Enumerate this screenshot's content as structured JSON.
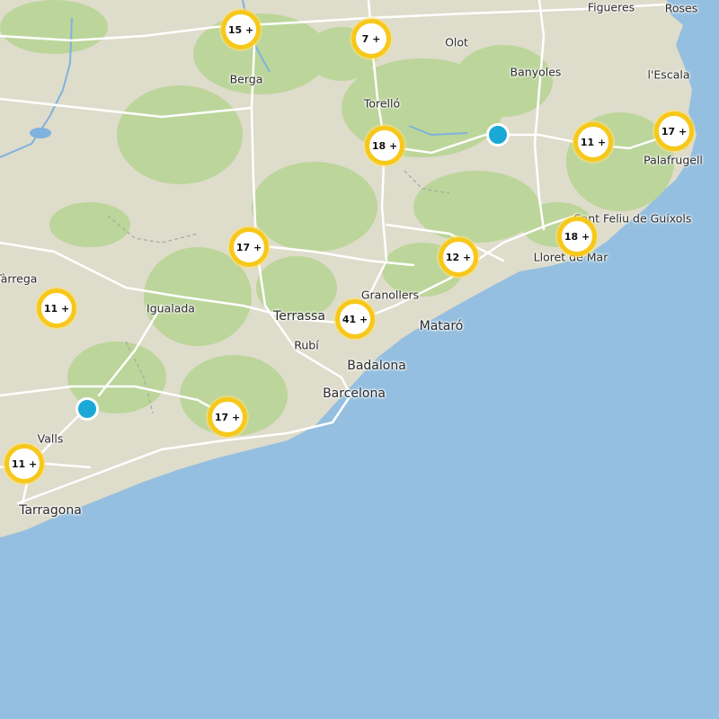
{
  "map": {
    "colors": {
      "sea": "#94bfe0",
      "land": "#dedccb",
      "forest": "#bcd59a",
      "road": "#ffffff",
      "river": "#7fb2dd",
      "border": "#a7a7a7",
      "cluster_ring": "#f7c81a",
      "point": "#1aa9d6"
    },
    "labels": {
      "figueres": "Figueres",
      "roses": "Roses",
      "olot": "Olot",
      "banyoles": "Banyoles",
      "lescala": "l'Escala",
      "berga": "Berga",
      "torello": "Torelló",
      "palafrugell": "Palafrugell",
      "santfeliu": "Sant Feliu de Guíxols",
      "lloret": "Lloret de Mar",
      "tarrega": "Tàrrega",
      "igualada": "Igualada",
      "granollers": "Granollers",
      "terrassa": "Terrassa",
      "mataro": "Mataró",
      "rubi": "Rubí",
      "badalona": "Badalona",
      "barcelona": "Barcelona",
      "valls": "Valls",
      "tarragona": "Tarragona"
    },
    "clusters": {
      "berga_north": "15 +",
      "olot_west": "7 +",
      "torello": "18 +",
      "lescala": "11 +",
      "palafrugell": "17 +",
      "berga_south": "17 +",
      "granollers_east": "12 +",
      "lloret": "18 +",
      "tarrega": "11 +",
      "terrassa": "41 +",
      "garraf": "17 +",
      "valls": "11 +"
    },
    "points": [
      "banyoles-point",
      "valls-point"
    ]
  }
}
